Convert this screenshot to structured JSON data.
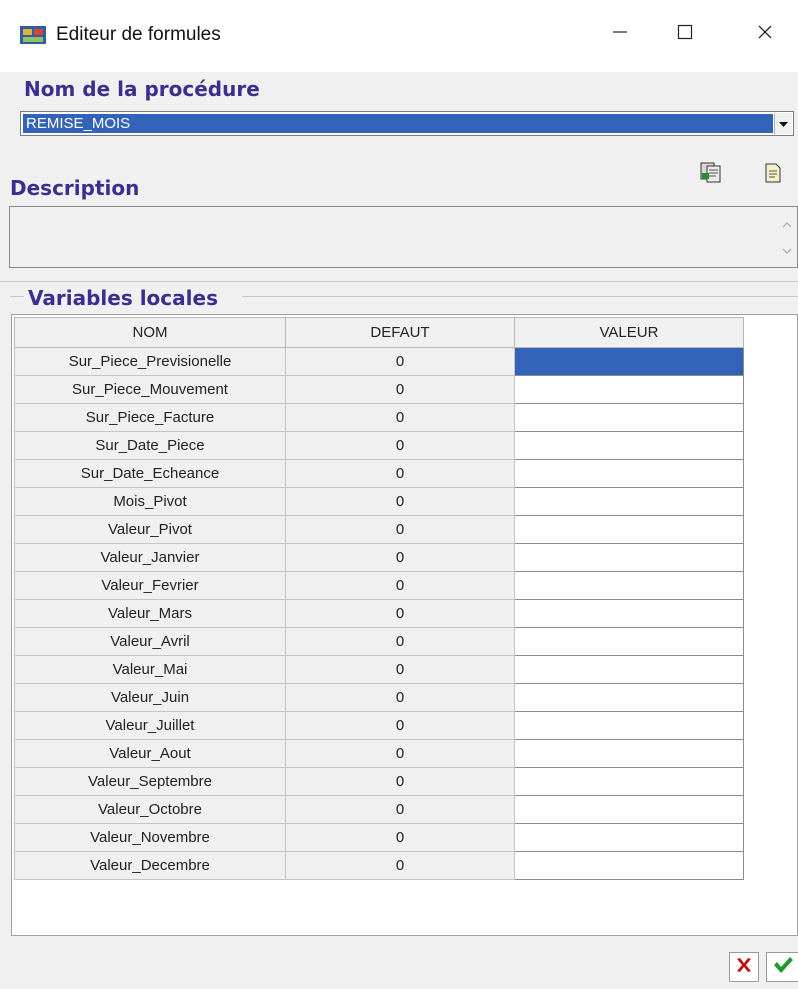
{
  "window": {
    "title": "Editeur de formules",
    "minimize_icon": "minimize-icon",
    "maximize_icon": "maximize-icon",
    "close_icon": "close-icon"
  },
  "procedure": {
    "label": "Nom de la procédure",
    "selected_value": "REMISE_MOIS"
  },
  "description": {
    "label": "Description",
    "value": ""
  },
  "toolbar": {
    "icons": [
      "copy-document-icon",
      "document-icon"
    ]
  },
  "variables": {
    "label": "Variables locales",
    "columns": [
      "NOM",
      "DEFAUT",
      "VALEUR"
    ],
    "rows": [
      {
        "nom": "Sur_Piece_Previsionelle",
        "defaut": "0",
        "valeur": ""
      },
      {
        "nom": "Sur_Piece_Mouvement",
        "defaut": "0",
        "valeur": ""
      },
      {
        "nom": "Sur_Piece_Facture",
        "defaut": "0",
        "valeur": ""
      },
      {
        "nom": "Sur_Date_Piece",
        "defaut": "0",
        "valeur": ""
      },
      {
        "nom": "Sur_Date_Echeance",
        "defaut": "0",
        "valeur": ""
      },
      {
        "nom": "Mois_Pivot",
        "defaut": "0",
        "valeur": ""
      },
      {
        "nom": "Valeur_Pivot",
        "defaut": "0",
        "valeur": ""
      },
      {
        "nom": "Valeur_Janvier",
        "defaut": "0",
        "valeur": ""
      },
      {
        "nom": "Valeur_Fevrier",
        "defaut": "0",
        "valeur": ""
      },
      {
        "nom": "Valeur_Mars",
        "defaut": "0",
        "valeur": ""
      },
      {
        "nom": "Valeur_Avril",
        "defaut": "0",
        "valeur": ""
      },
      {
        "nom": "Valeur_Mai",
        "defaut": "0",
        "valeur": ""
      },
      {
        "nom": "Valeur_Juin",
        "defaut": "0",
        "valeur": ""
      },
      {
        "nom": "Valeur_Juillet",
        "defaut": "0",
        "valeur": ""
      },
      {
        "nom": "Valeur_Aout",
        "defaut": "0",
        "valeur": ""
      },
      {
        "nom": "Valeur_Septembre",
        "defaut": "0",
        "valeur": ""
      },
      {
        "nom": "Valeur_Octobre",
        "defaut": "0",
        "valeur": ""
      },
      {
        "nom": "Valeur_Novembre",
        "defaut": "0",
        "valeur": ""
      },
      {
        "nom": "Valeur_Decembre",
        "defaut": "0",
        "valeur": ""
      }
    ]
  },
  "footer": {
    "cancel_icon": "red-x-icon",
    "ok_icon": "green-check-icon"
  },
  "colors": {
    "accent_label": "#3a2f8e",
    "selection": "#3263b8",
    "cancel": "#c0161a",
    "ok": "#1e9a2e"
  }
}
